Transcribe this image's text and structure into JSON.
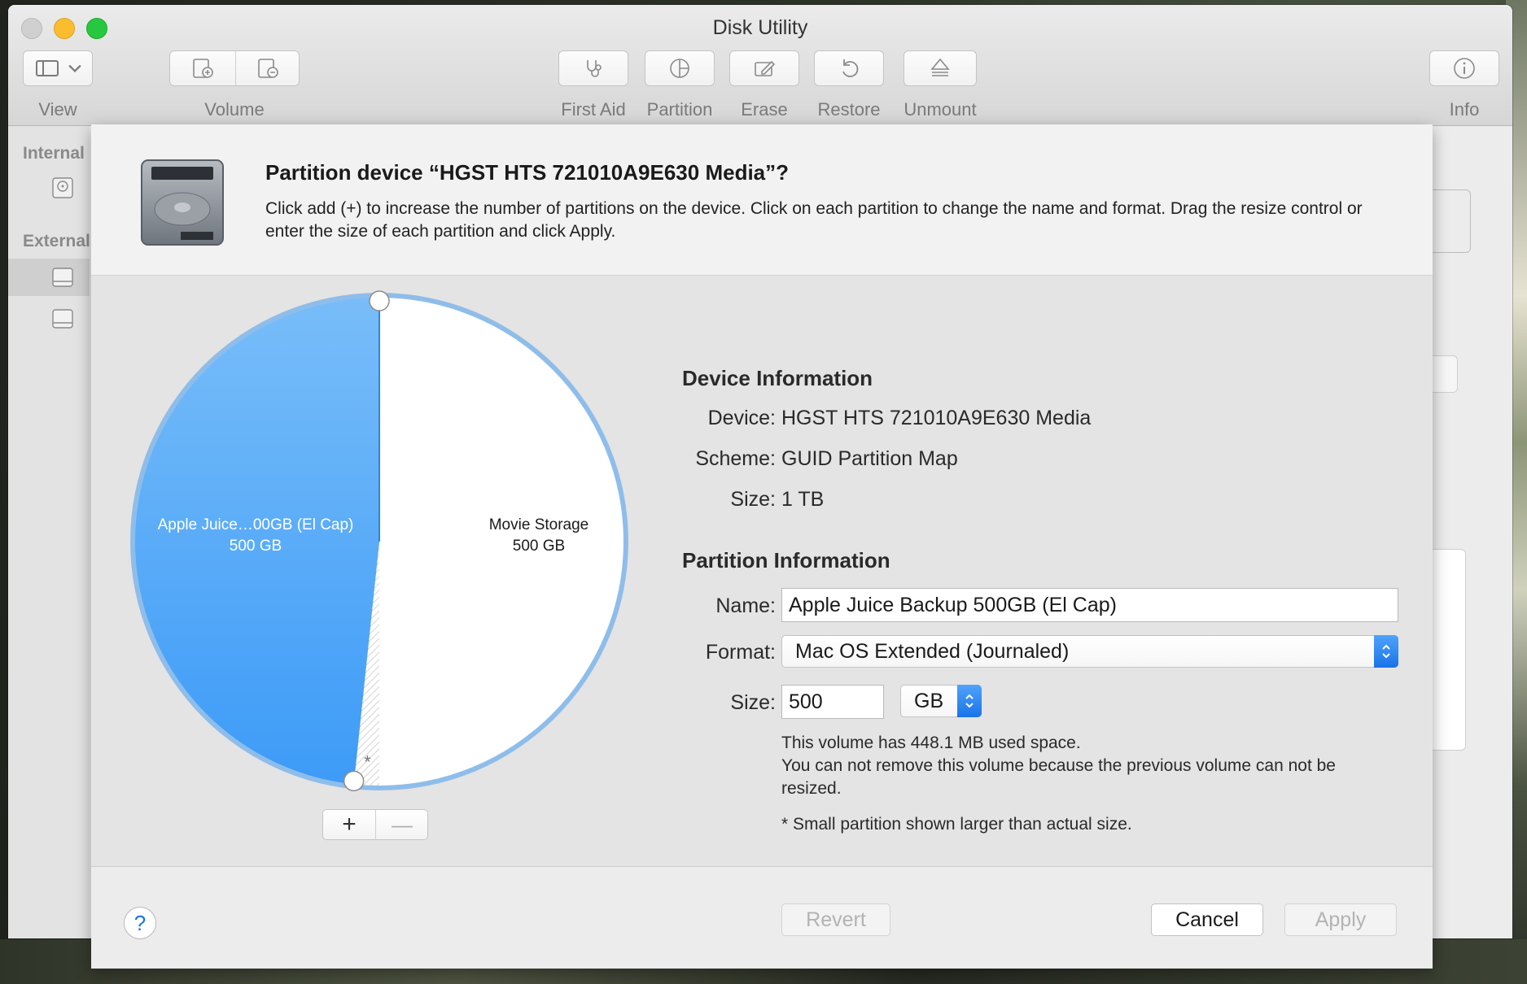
{
  "window": {
    "title": "Disk Utility"
  },
  "toolbar": {
    "view_label": "View",
    "volume_label": "Volume",
    "first_aid_label": "First Aid",
    "partition_label": "Partition",
    "erase_label": "Erase",
    "restore_label": "Restore",
    "unmount_label": "Unmount",
    "info_label": "Info"
  },
  "sidebar": {
    "internal_heading": "Internal",
    "external_heading": "External"
  },
  "sheet": {
    "title": "Partition device “HGST HTS 721010A9E630 Media”?",
    "description": "Click add (+) to increase the number of partitions on the device. Click on each partition to change the name and format. Drag the resize control or enter the size of each partition and click Apply."
  },
  "pie": {
    "partitions": [
      {
        "name": "Apple Juice…00GB (El Cap)",
        "size": "500 GB",
        "color": "#3d9bf7"
      },
      {
        "name": "Movie Storage",
        "size": "500 GB",
        "color": "#ffffff"
      }
    ],
    "small_marker": "*",
    "ring_color": "#8fbdea"
  },
  "device_info": {
    "heading": "Device Information",
    "device_key": "Device:",
    "device_val": "HGST HTS 721010A9E630 Media",
    "scheme_key": "Scheme:",
    "scheme_val": "GUID Partition Map",
    "size_key": "Size:",
    "size_val": "1 TB"
  },
  "partition_info": {
    "heading": "Partition Information",
    "name_key": "Name:",
    "name_val": "Apple Juice Backup 500GB (El Cap)",
    "format_key": "Format:",
    "format_val": "Mac OS Extended (Journaled)",
    "size_key": "Size:",
    "size_val": "500",
    "unit_val": "GB",
    "used_note": "This volume has 448.1 MB used space.",
    "remove_note": "You can not remove this volume because the previous volume can not be resized.",
    "small_note": "* Small partition shown larger than actual size."
  },
  "buttons": {
    "add": "+",
    "remove": "—",
    "help": "?",
    "revert": "Revert",
    "cancel": "Cancel",
    "apply": "Apply"
  },
  "colors": {
    "accent": "#1a73e8"
  }
}
